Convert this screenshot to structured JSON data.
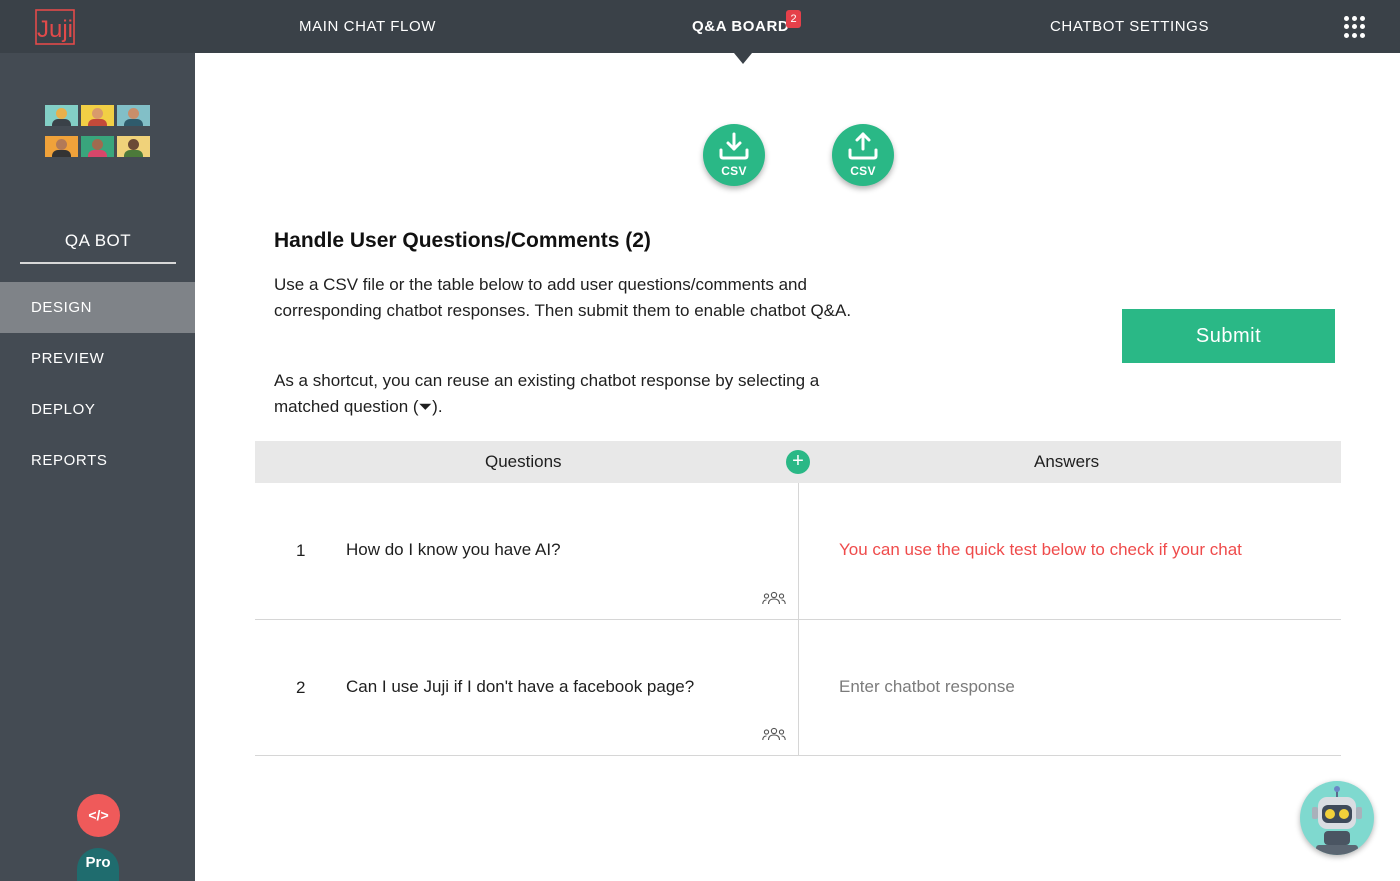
{
  "app": {
    "logo_text": "Juji"
  },
  "topnav": {
    "items": [
      {
        "label": "MAIN CHAT FLOW"
      },
      {
        "label": "Q&A BOARD",
        "badge": "2"
      },
      {
        "label": "CHATBOT SETTINGS"
      }
    ],
    "apps_icon": "grid-icon"
  },
  "sidebar": {
    "bot_name": "QA BOT",
    "items": [
      {
        "label": "DESIGN",
        "active": true
      },
      {
        "label": "PREVIEW"
      },
      {
        "label": "DEPLOY"
      },
      {
        "label": "REPORTS"
      }
    ],
    "code_button": "</>",
    "plan_badge": "Pro"
  },
  "csv": {
    "download_label": "CSV",
    "upload_label": "CSV"
  },
  "content": {
    "title": "Handle User Questions/Comments (2)",
    "description": "Use a CSV file or the table below to add user questions/comments and corresponding chatbot responses. Then submit them to enable chatbot Q&A.",
    "shortcut": "As a shortcut, you can reuse an existing chatbot response by selecting a matched question (⏷).",
    "submit_label": "Submit"
  },
  "table": {
    "headers": {
      "questions": "Questions",
      "answers": "Answers"
    },
    "add_symbol": "+",
    "rows": [
      {
        "num": "1",
        "question": "How do I know you have AI?",
        "answer": "You can use the quick test below to check if your chat",
        "answer_placeholder": ""
      },
      {
        "num": "2",
        "question": "Can I use Juji if I don't have a facebook page?",
        "answer": "",
        "answer_placeholder": "Enter chatbot response"
      }
    ]
  },
  "colors": {
    "topbar": "#3a4148",
    "sidebar": "#444b53",
    "accent_green": "#2ab886",
    "answer_red": "#ef4b4b",
    "badge_red": "#e5404a"
  }
}
